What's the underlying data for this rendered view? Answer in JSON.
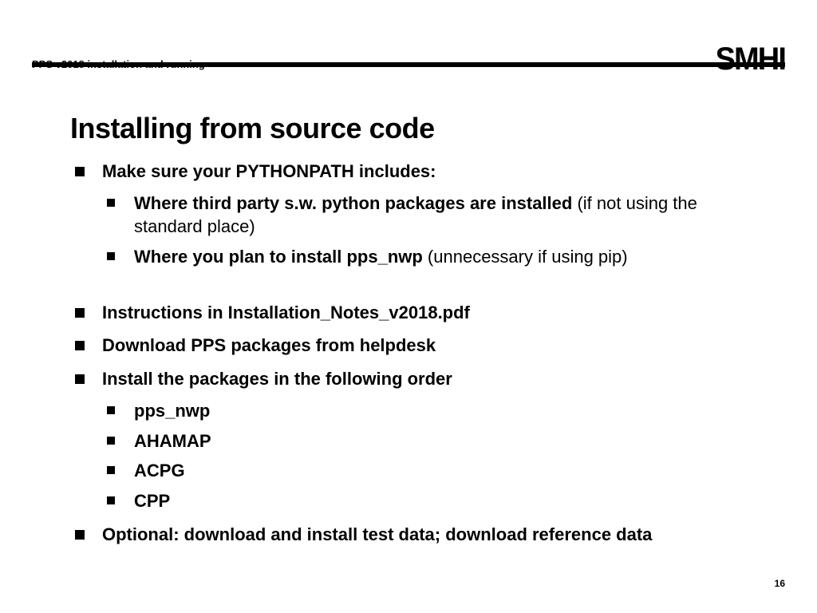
{
  "header": {
    "title": "PPS v2018 installation and running",
    "logo": "SMHI"
  },
  "slide": {
    "title": "Installing from source code"
  },
  "bullets": {
    "b1": "Make sure your PYTHONPATH includes:",
    "b1s1_bold": "Where third party s.w. python packages are installed ",
    "b1s1_note": "(if not using the standard place)",
    "b1s2_bold": "Where you plan to install pps_nwp ",
    "b1s2_note": "(unnecessary if using pip)",
    "b2": "Instructions in Installation_Notes_v2018.pdf",
    "b3": "Download PPS packages from helpdesk",
    "b4": "Install the packages in the following order",
    "b4s1": "pps_nwp",
    "b4s2": "AHAMAP",
    "b4s3": "ACPG",
    "b4s4": "CPP",
    "b5": "Optional: download and install test data; download reference data"
  },
  "page": "16"
}
